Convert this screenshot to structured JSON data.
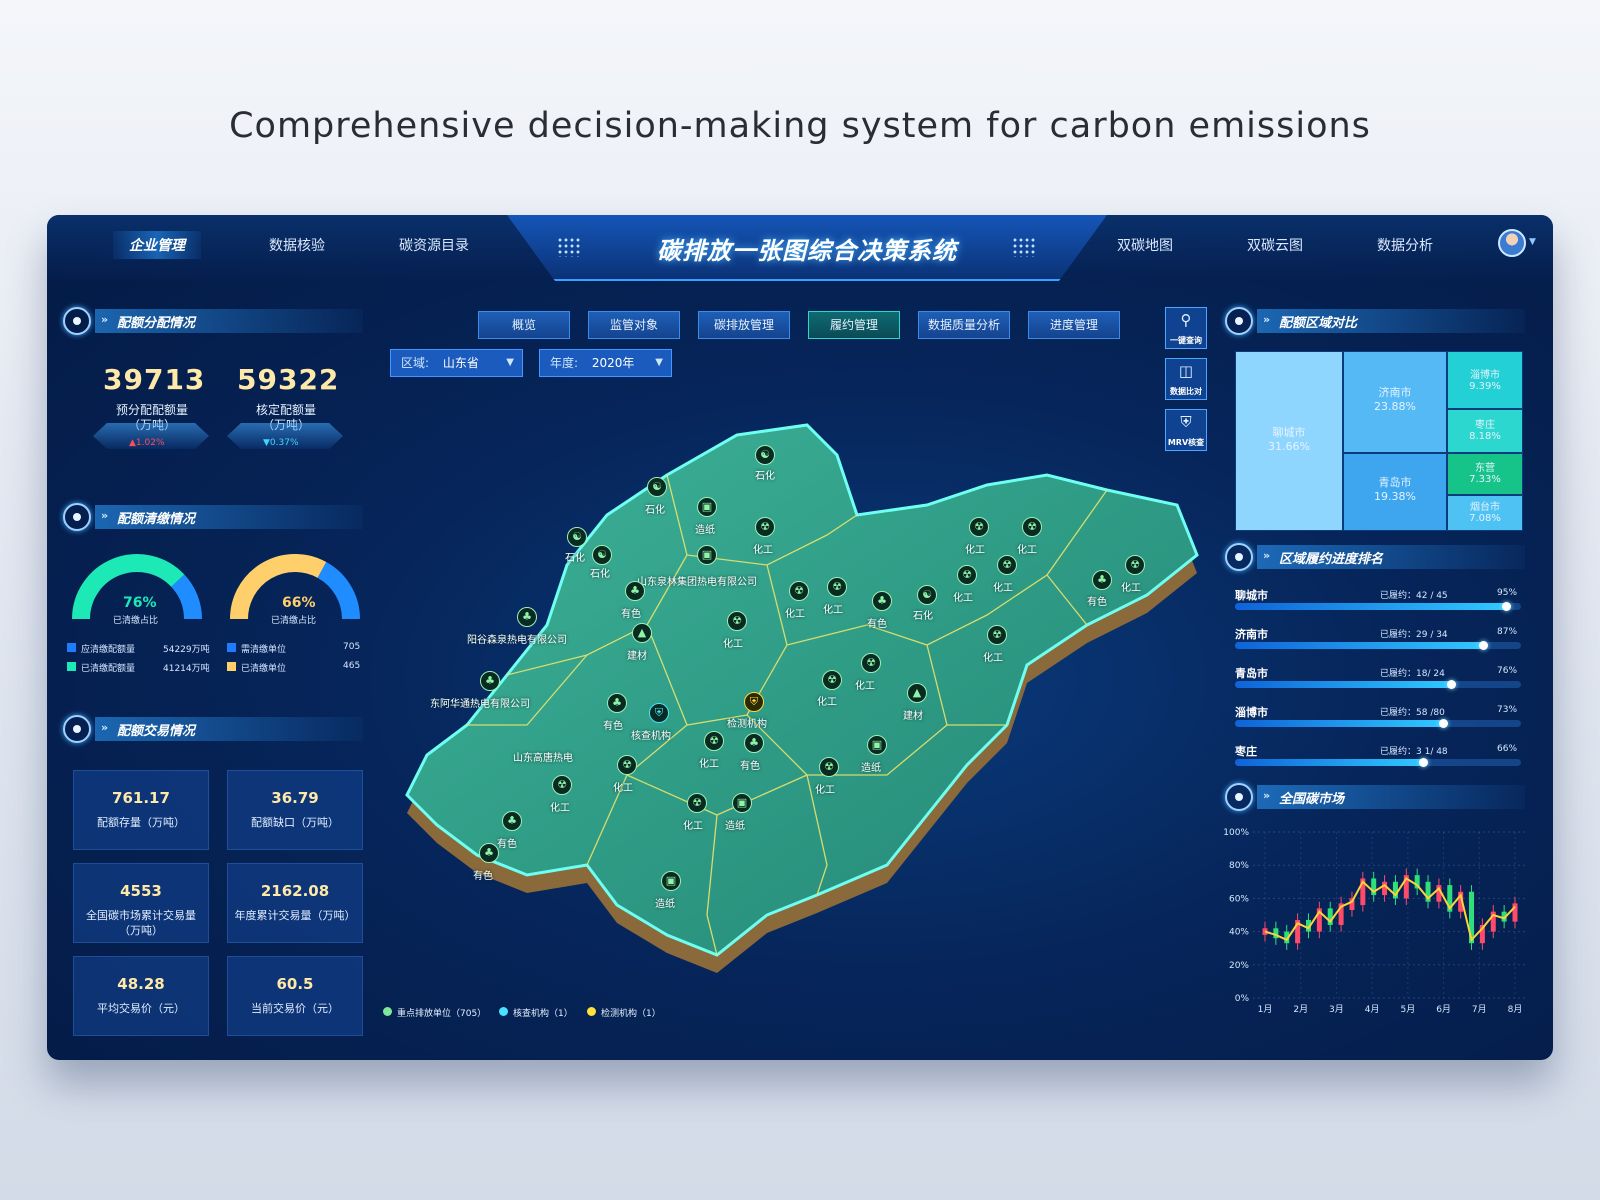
{
  "hero_title": "Comprehensive decision-making system for carbon emissions",
  "nav": {
    "left": [
      "企业管理",
      "数据核验",
      "碳资源目录"
    ],
    "right": [
      "双碳地图",
      "双碳云图",
      "数据分析"
    ],
    "active": "企业管理"
  },
  "system_title": "碳排放一张图综合决策系统",
  "tabs": [
    "概览",
    "监管对象",
    "碳排放管理",
    "履约管理",
    "数据质量分析",
    "进度管理"
  ],
  "active_tab": "履约管理",
  "filters": {
    "region_label": "区域:",
    "region_value": "山东省",
    "year_label": "年度:",
    "year_value": "2020年"
  },
  "tools": [
    {
      "icon": "search-icon",
      "label": "一键查询"
    },
    {
      "icon": "compare-icon",
      "label": "数据比对"
    },
    {
      "icon": "shield-icon",
      "label": "MRV核查"
    }
  ],
  "quota_allocation": {
    "title": "配额分配情况",
    "items": [
      {
        "value": "39713",
        "label": "预分配配额量",
        "unit": "（万吨）",
        "delta": "▲1.02%",
        "delta_color": "#ff4a5a"
      },
      {
        "value": "59322",
        "label": "核定配额量",
        "unit": "（万吨）",
        "delta": "▼0.37%",
        "delta_color": "#3fd6ff"
      }
    ]
  },
  "quota_clearance": {
    "title": "配额清缴情况",
    "gauges": [
      {
        "pct": "76%",
        "pct_value": 0.76,
        "label": "已清缴占比",
        "color": "#1de9b6",
        "rest_color": "#1f8cff"
      },
      {
        "pct": "66%",
        "pct_value": 0.66,
        "label": "已清缴占比",
        "color": "#ffcf6b",
        "rest_color": "#1f8cff"
      }
    ],
    "legend_left": [
      {
        "label": "应清缴配额量",
        "value": "54229万吨",
        "color": "#1f7cff"
      },
      {
        "label": "已清缴配额量",
        "value": "41214万吨",
        "color": "#1de9b6"
      }
    ],
    "legend_right": [
      {
        "label": "需清缴单位",
        "value": "705",
        "color": "#1f7cff"
      },
      {
        "label": "已清缴单位",
        "value": "465",
        "color": "#ffcf6b"
      }
    ]
  },
  "quota_trade": {
    "title": "配额交易情况",
    "tiles": [
      {
        "value": "761.17",
        "label": "配额存量（万吨）"
      },
      {
        "value": "36.79",
        "label": "配额缺口（万吨）"
      },
      {
        "value": "4553",
        "label": "全国碳市场累计交易量（万吨）"
      },
      {
        "value": "2162.08",
        "label": "年度累计交易量（万吨）"
      },
      {
        "value": "48.28",
        "label": "平均交易价（元）"
      },
      {
        "value": "60.5",
        "label": "当前交易价（元）"
      }
    ]
  },
  "region_compare": {
    "title": "配额区域对比",
    "cells": [
      {
        "name": "聊城市",
        "pct": "31.66%",
        "bg": "#8fd6ff",
        "fg": "#ffffff"
      },
      {
        "name": "济南市",
        "pct": "23.88%",
        "bg": "#55b9f5",
        "fg": "#ffffff"
      },
      {
        "name": "青岛市",
        "pct": "19.38%",
        "bg": "#3ea6ee",
        "fg": "#ffffff"
      },
      {
        "name": "淄博市",
        "pct": "9.39%",
        "bg": "#22d0d6",
        "fg": "#ffffff"
      },
      {
        "name": "枣庄",
        "pct": "8.18%",
        "bg": "#2bd7cf",
        "fg": "#ffffff"
      },
      {
        "name": "东营",
        "pct": "7.33%",
        "bg": "#16c48a",
        "fg": "#ffffff"
      },
      {
        "name": "烟台市",
        "pct": "7.08%",
        "bg": "#4ec3f3",
        "fg": "#ffffff"
      }
    ]
  },
  "progress_rank": {
    "title": "区域履约进度排名",
    "rows": [
      {
        "city": "聊城市",
        "done": "已履约：42 / 45",
        "pct": "95%",
        "value": 0.95
      },
      {
        "city": "济南市",
        "done": "已履约：29 / 34",
        "pct": "87%",
        "value": 0.87
      },
      {
        "city": "青岛市",
        "done": "已履约：18/ 24",
        "pct": "76%",
        "value": 0.76
      },
      {
        "city": "淄博市",
        "done": "已履约：58 /80",
        "pct": "73%",
        "value": 0.73
      },
      {
        "city": "枣庄",
        "done": "已履约：3 1/ 48",
        "pct": "66%",
        "value": 0.66
      }
    ]
  },
  "national_market": {
    "title": "全国碳市场"
  },
  "chart_data": {
    "type": "line",
    "categories": [
      "1月",
      "2月",
      "3月",
      "4月",
      "5月",
      "6月",
      "7月",
      "8月"
    ],
    "y_ticks": [
      "100%",
      "80%",
      "60%",
      "40%",
      "20%",
      "0%"
    ],
    "ylim": [
      0,
      100
    ],
    "grid": true,
    "series": [
      {
        "values": [
          40,
          38,
          35,
          45,
          42,
          52,
          46,
          55,
          58,
          70,
          64,
          68,
          62,
          72,
          68,
          60,
          66,
          54,
          62,
          35,
          42,
          50,
          48,
          55
        ],
        "color": "#ffd23a"
      }
    ],
    "candle_up_color": "#ff4a6a",
    "candle_down_color": "#2fe07a"
  },
  "map": {
    "markers": [
      {
        "label": "石化",
        "type": "green"
      },
      {
        "label": "造纸",
        "type": "green"
      },
      {
        "label": "化工",
        "type": "green"
      },
      {
        "label": "有色",
        "type": "green"
      },
      {
        "label": "建材",
        "type": "green"
      },
      {
        "label": "核查机构",
        "type": "cyan"
      },
      {
        "label": "检测机构",
        "type": "yellow"
      }
    ],
    "places": [
      "山东泉林集团热电有限公司",
      "阳谷森泉热电有限公司",
      "东阿华通热电有限公司",
      "山东高唐热电"
    ],
    "legend": [
      {
        "label": "重点排放单位（705）",
        "color": "#7ee89a"
      },
      {
        "label": "核查机构（1）",
        "color": "#49e3ff"
      },
      {
        "label": "检测机构（1）",
        "color": "#ffe23a"
      }
    ]
  }
}
